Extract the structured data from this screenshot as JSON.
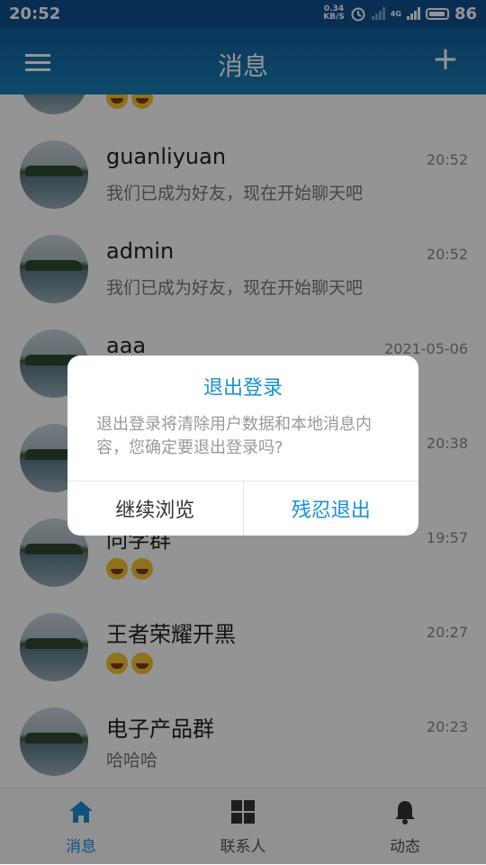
{
  "status_bar": {
    "time": "20:52",
    "speed_value": "0.34",
    "speed_unit": "KB/S",
    "network": "4G",
    "battery": "86"
  },
  "app_bar": {
    "title": "消息",
    "plus": "+"
  },
  "conversations": [
    {
      "name": "",
      "message": "",
      "time": "",
      "emojis": 2
    },
    {
      "name": "guanliyuan",
      "message": "我们已成为好友，现在开始聊天吧",
      "time": "20:52"
    },
    {
      "name": "admin",
      "message": "我们已成为好友，现在开始聊天吧",
      "time": "20:52"
    },
    {
      "name": "aaa",
      "message": "",
      "time": "2021-05-06"
    },
    {
      "name": "",
      "message": "",
      "time": "20:38"
    },
    {
      "name": "同学群",
      "message": "",
      "time": "19:57",
      "emojis": 2
    },
    {
      "name": "王者荣耀开黑",
      "message": "",
      "time": "20:27",
      "emojis": 2
    },
    {
      "name": "电子产品群",
      "message": "哈哈哈",
      "time": "20:23"
    }
  ],
  "tabs": [
    {
      "label": "消息",
      "icon": "home-icon",
      "active": true
    },
    {
      "label": "联系人",
      "icon": "grid-icon",
      "active": false
    },
    {
      "label": "动态",
      "icon": "bell-icon",
      "active": false
    }
  ],
  "dialog": {
    "title": "退出登录",
    "body": "退出登录将清除用户数据和本地消息内容，您确定要退出登录吗?",
    "cancel": "继续浏览",
    "confirm": "残忍退出"
  },
  "colors": {
    "accent": "#1a8fd3",
    "app_bar": "#1a7fb7",
    "status_bar": "#11508f"
  }
}
